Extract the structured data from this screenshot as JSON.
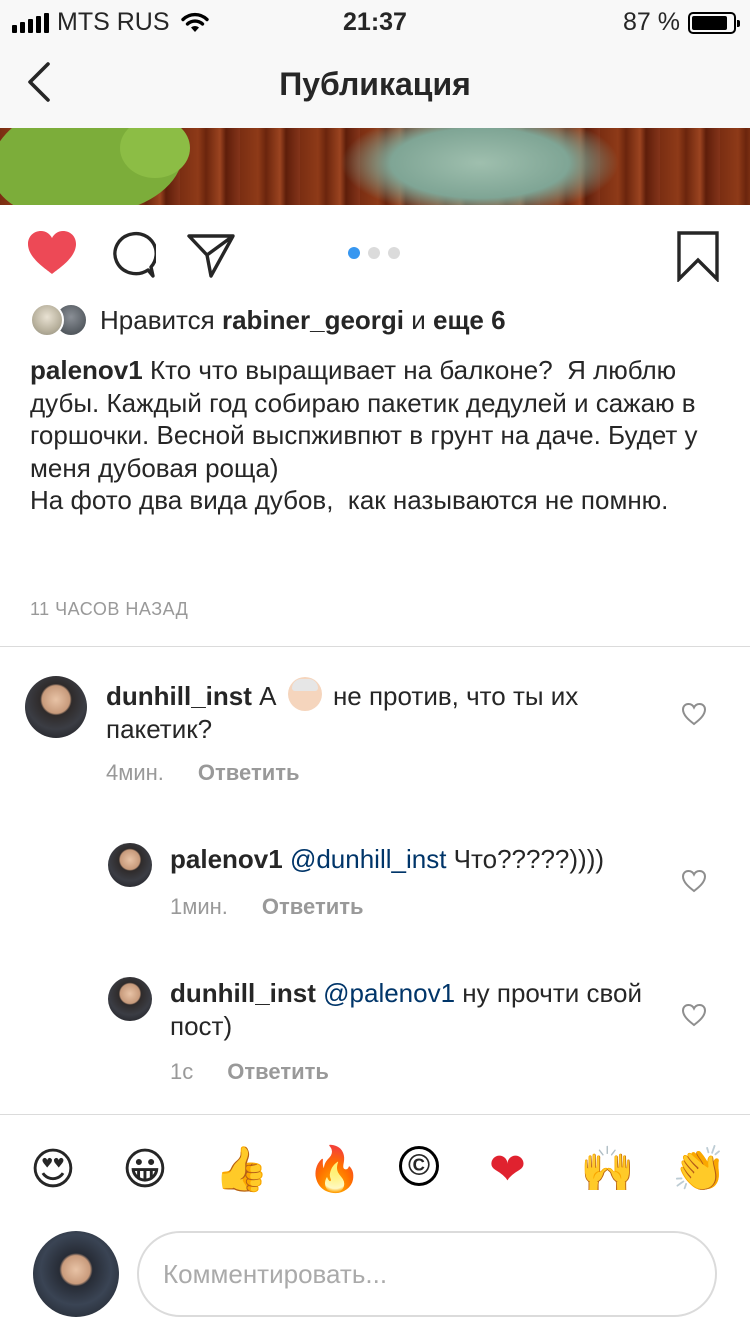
{
  "status_bar": {
    "carrier": "MTS RUS",
    "time": "21:37",
    "battery_text": "87 %",
    "battery_level": 0.87
  },
  "header": {
    "title": "Публикация"
  },
  "post": {
    "carousel_total": 3,
    "carousel_active": 1,
    "likes": {
      "prefix": "Нравится",
      "user": "rabiner_georgi",
      "conj": "и",
      "others": "еще 6"
    },
    "author": "palenov1",
    "caption": "Кто что выращивает на балконе?  Я люблю дубы. Каждый год собираю пакетик дедулей и сажаю в горшочки. Весной выспживпют в грунт на даче. Будет у меня дубовая роща)\nНа фото два вида дубов,  как называются не помню.",
    "time_ago": "11 ЧАСОВ НАЗАД"
  },
  "comments": [
    {
      "user": "dunhill_inst",
      "text_before": "А",
      "emoji": "old-man-emoji",
      "text_after": "не против, что ты их пакетик?",
      "time": "4мин.",
      "reply_label": "Ответить"
    },
    {
      "user": "palenov1",
      "mention": "@dunhill_inst",
      "text": "Что?????))))",
      "time": "1мин.",
      "reply_label": "Ответить"
    },
    {
      "user": "dunhill_inst",
      "mention": "@palenov1",
      "text": "ну прочти свой пост)",
      "time": "1с",
      "reply_label": "Ответить"
    }
  ],
  "emoji_bar": {
    "items": [
      "😍",
      "😀",
      "👍",
      "🔥",
      "©",
      "❤",
      "🙌",
      "👏"
    ]
  },
  "composer": {
    "placeholder": "Комментировать..."
  },
  "colors": {
    "like_red": "#ed4956",
    "link_blue": "#003569",
    "dot_active": "#3897f0"
  }
}
